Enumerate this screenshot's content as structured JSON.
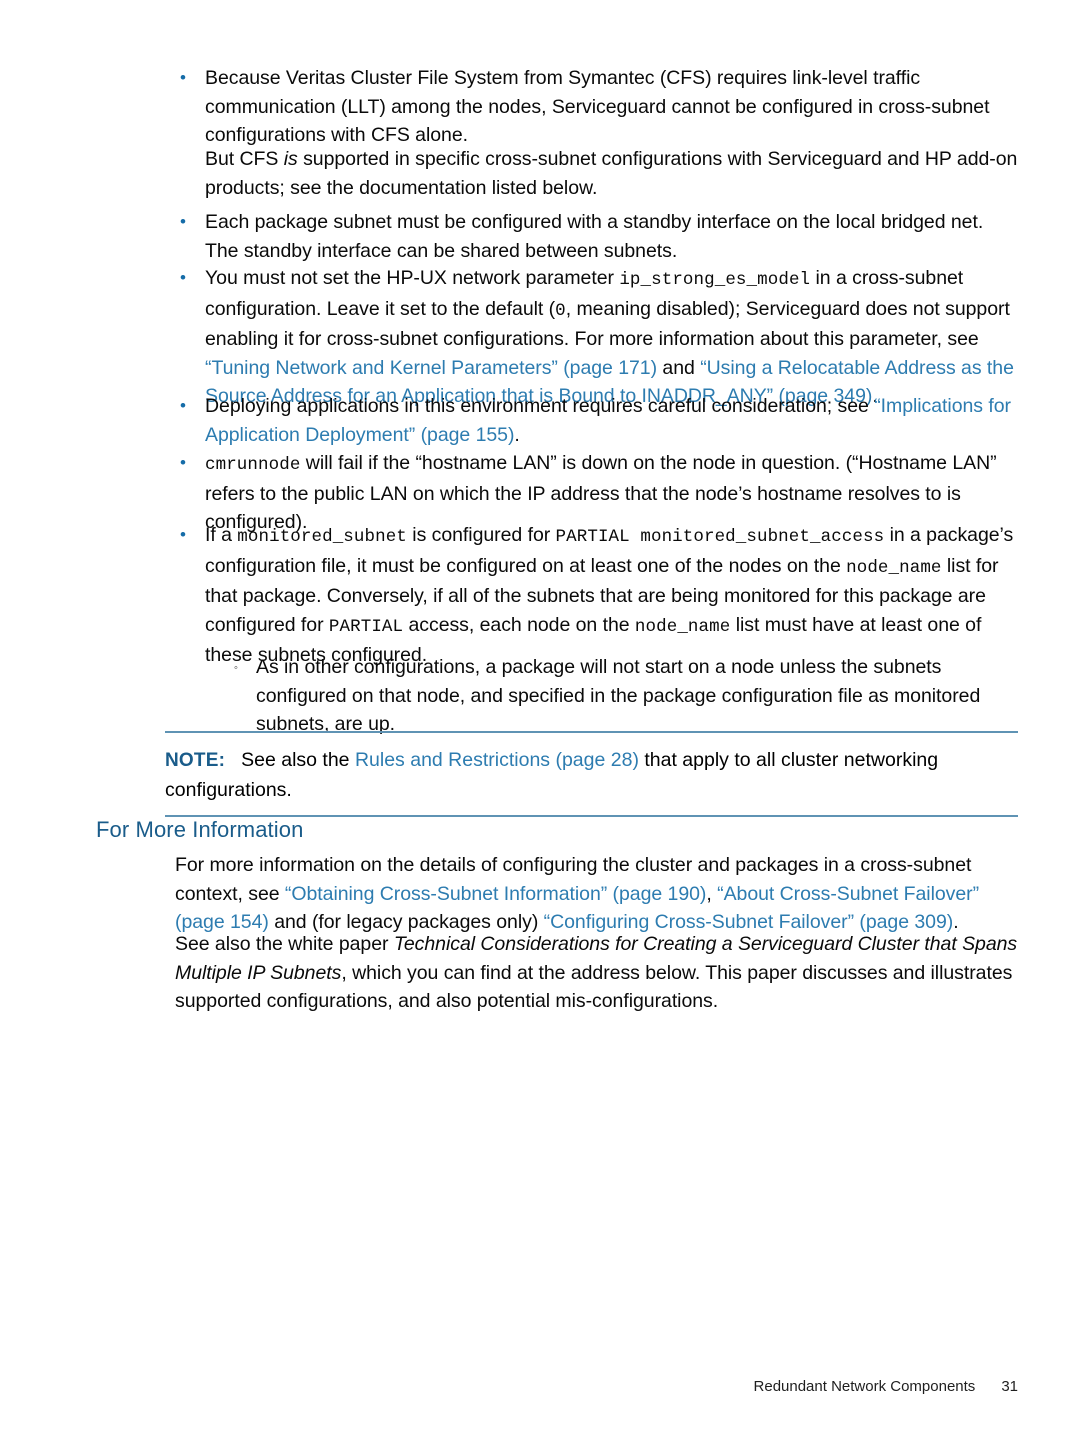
{
  "document": {
    "title": "Redundant Network Components",
    "page_number": "31"
  },
  "bullets": {
    "cfs": {
      "marker": "•",
      "line1": "Because Veritas Cluster File System from Symantec (CFS) requires link-level traffic communication",
      "line2": "(LLT) among the nodes, Serviceguard cannot be configured in cross-subnet configurations with",
      "line3": "CFS alone.",
      "followup_pre": "But CFS ",
      "followup_italic": "is",
      "followup_post": " supported in specific cross-subnet configurations with Serviceguard and HP add-on products; see the documentation listed below."
    },
    "standby": {
      "marker": "•",
      "text": "Each package subnet must be configured with a standby interface on the local bridged net. The standby interface can be shared between subnets."
    },
    "ip_strong": {
      "marker": "•",
      "part1": "You must not set the HP-UX network parameter ",
      "code1": "ip_strong_es_model",
      "part2": " in a cross-subnet configuration. Leave it set to the default (",
      "code2": "0",
      "part3": ", meaning disabled); Serviceguard does not support enabling it for cross-subnet configurations. For more information about this parameter, see ",
      "link1": "“Tuning Network and Kernel Parameters” (page 171)",
      "part4": " and ",
      "link2": "“Using a Relocatable Address as the Source Address for an Application that is Bound to INADDR_ANY” (page 349)",
      "part5": "."
    },
    "deploying": {
      "marker": "•",
      "part1": "Deploying applications in this environment requires careful consideration; see ",
      "link1": "“Implications for Application Deployment” (page 155)",
      "part2": "."
    },
    "cmrunnode": {
      "marker": "•",
      "code1": "cmrunnode",
      "part1": " will fail if the “hostname LAN” is down on the node in question. (“Hostname LAN” refers to the public LAN on which the IP address that the node’s hostname resolves to is configured)."
    },
    "monitored_subnet": {
      "marker": "•",
      "part1": "If a ",
      "code1": "monitored_subnet",
      "part2": " is configured for ",
      "code2": "PARTIAL monitored_subnet_access",
      "part3": " in a package’s configuration file, it must be configured on at least one of the nodes on the ",
      "code3": "node_name",
      "part4": " list for that package. Conversely, if all of the subnets that are being monitored for this package are configured for ",
      "code4": "PARTIAL",
      "part5": " access, each node on the ",
      "code5": "node_name",
      "part6": " list must have at least one of these subnets configured.",
      "sub": {
        "marker": "◦",
        "text": "As in other configurations, a package will not start on a node unless the subnets configured on that node, and specified in the package configuration file as monitored subnets, are up."
      }
    }
  },
  "note": {
    "label": "NOTE:",
    "part1": "See also the ",
    "link1": "Rules and Restrictions (page 28)",
    "part2": " that apply to all cluster networking configurations."
  },
  "section": {
    "heading": "For More Information",
    "para1": {
      "part1": "For more information on the details of configuring the cluster and packages in a cross-subnet context, see ",
      "link1": "“Obtaining Cross-Subnet Information” (page 190)",
      "part2": ", ",
      "link2": "“About Cross-Subnet Failover” (page 154)",
      "part3": " and (for legacy packages only) ",
      "link3": "“Configuring Cross-Subnet Failover” (page 309)",
      "part4": "."
    },
    "para2": {
      "part1": "See also the white paper ",
      "italic1": "Technical Considerations for Creating a Serviceguard Cluster that Spans Multiple IP Subnets",
      "part2": ", which you can find at the address below. This paper discusses and illustrates supported configurations, and also potential mis-configurations."
    }
  },
  "colors": {
    "link": "#2d7cb0",
    "heading": "#1a5c8a",
    "bullet": "#156ca8",
    "rule": "#5f93b4"
  }
}
